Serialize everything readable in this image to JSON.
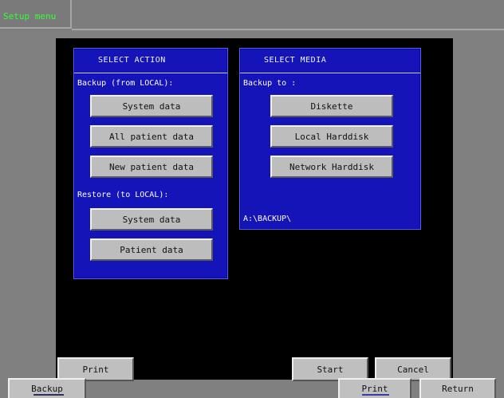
{
  "title_bar": {
    "label": "Setup menu"
  },
  "select_action": {
    "header": "SELECT ACTION",
    "backup_label": "Backup (from LOCAL):",
    "backup_buttons": [
      "System data",
      "All patient data",
      "New patient data"
    ],
    "restore_label": "Restore (to LOCAL):",
    "restore_buttons": [
      "System data",
      "Patient data"
    ]
  },
  "select_media": {
    "header": "SELECT MEDIA",
    "backup_to_label": "Backup to    :",
    "buttons": [
      "Diskette",
      "Local Harddisk",
      "Network Harddisk"
    ],
    "path": "A:\\BACKUP\\"
  },
  "dialog_buttons": {
    "print": "Print",
    "start": "Start",
    "cancel": "Cancel"
  },
  "footer_tabs": {
    "backup": "Backup",
    "print": "Print",
    "return": "Return"
  },
  "colors": {
    "title_text": "#34ff34",
    "panel_blue": "#1414b8",
    "button_gray": "#bdbdbd",
    "main_background": "#000000"
  }
}
